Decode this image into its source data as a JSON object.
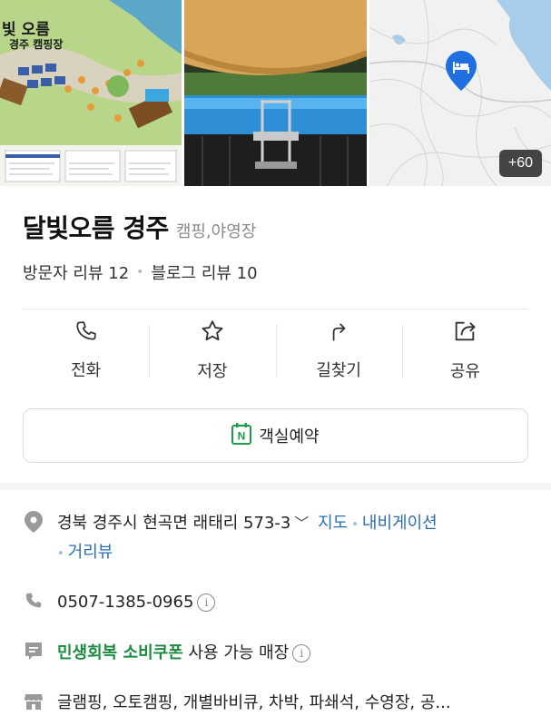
{
  "photos": {
    "illust_title_1": "빛 오름",
    "illust_title_2": "경주 캠핑장",
    "more_count": "+60"
  },
  "place": {
    "name": "달빛오름 경주",
    "category": "캠핑,야영장",
    "visitor_review": "방문자 리뷰 12",
    "blog_review": "블로그 리뷰 10"
  },
  "actions": {
    "call": "전화",
    "save": "저장",
    "directions": "길찾기",
    "share": "공유"
  },
  "booking": {
    "label": "객실예약",
    "badge": "N"
  },
  "info": {
    "address": "경북 경주시 현곡면 래태리 573-3",
    "map_link": "지도",
    "navigation_link": "내비게이션",
    "street_view_link": "거리뷰",
    "phone": "0507-1385-0965",
    "coupon_highlight": "민생회복 소비쿠폰",
    "coupon_rest": "사용 가능 매장",
    "facilities": "글램핑, 오토캠핑, 개별바비큐, 차박, 파쇄석, 수영장, 공..."
  },
  "colors": {
    "link": "#2a6fb0",
    "naver_green": "#1a8a3e",
    "pin_blue": "#1f6fe0"
  }
}
